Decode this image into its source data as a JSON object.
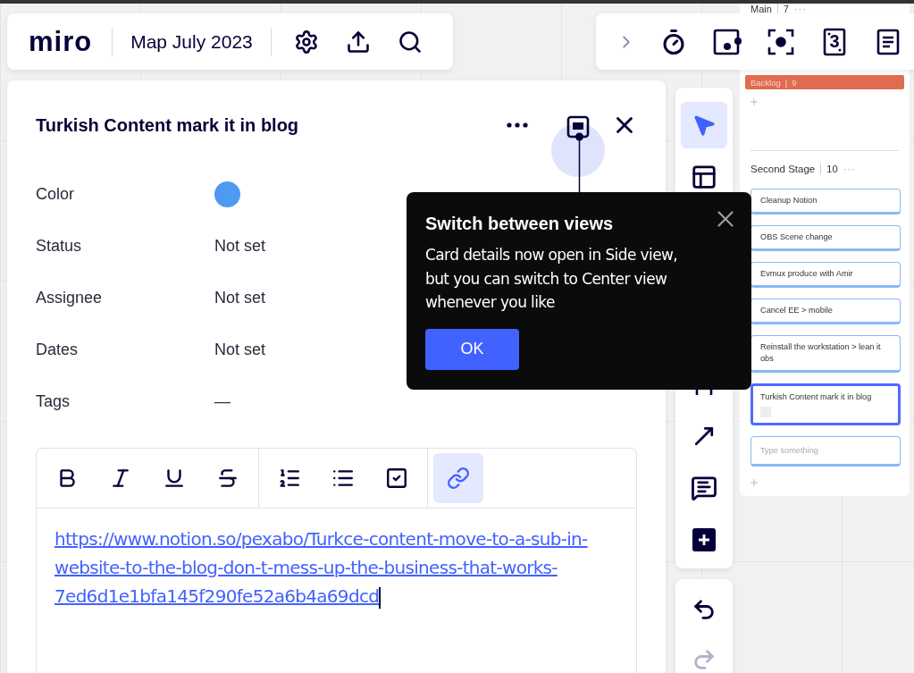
{
  "header": {
    "logo": "miro",
    "board_title": "Map July 2023",
    "tools": [
      {
        "kind": "settings"
      },
      {
        "kind": "upload"
      },
      {
        "kind": "search"
      }
    ]
  },
  "top_tools": [
    {
      "kind": "expand"
    },
    {
      "kind": "timer"
    },
    {
      "kind": "card-dot"
    },
    {
      "kind": "focus"
    },
    {
      "kind": "card-number",
      "label": "3"
    },
    {
      "kind": "notes"
    }
  ],
  "card_panel": {
    "title": "Turkish Content mark it in blog",
    "view_toggle_highlighted": true,
    "fields": [
      {
        "label": "Color",
        "kind": "color",
        "color": "#4e9af1"
      },
      {
        "label": "Status",
        "kind": "text",
        "value": "Not set"
      },
      {
        "label": "Assignee",
        "kind": "text",
        "value": "Not set"
      },
      {
        "label": "Dates",
        "kind": "text",
        "value": "Not set"
      },
      {
        "label": "Tags",
        "kind": "text",
        "value": "—"
      }
    ],
    "editor": {
      "tools": [
        {
          "kind": "bold",
          "selected": false
        },
        {
          "kind": "italic",
          "selected": false
        },
        {
          "kind": "underline",
          "selected": false
        },
        {
          "kind": "strike",
          "selected": false
        },
        {
          "kind": "ordered-list",
          "selected": false
        },
        {
          "kind": "bullet-list",
          "selected": false
        },
        {
          "kind": "checklist",
          "selected": false
        },
        {
          "kind": "link",
          "selected": true
        }
      ],
      "link": "https://www.notion.so/pexabo/Turkce-content-move-to-a-sub-in-website-to-the-blog-don-t-mess-up-the-business-that-works-7ed6d1e1bfa145f290fe52a6b4a69dcd"
    }
  },
  "tooltip": {
    "title": "Switch between views",
    "body": "Card details now open in Side view, but you can switch to Center view whenever you like",
    "button": "OK"
  },
  "toolbar": {
    "tools": [
      {
        "kind": "select",
        "selected": true
      },
      {
        "kind": "layout",
        "selected": false
      },
      {
        "kind": "arch",
        "selected": false
      },
      {
        "kind": "arrow",
        "selected": false
      },
      {
        "kind": "comment",
        "selected": false
      },
      {
        "kind": "add",
        "selected": false
      }
    ],
    "history": [
      {
        "kind": "undo",
        "disabled": false
      },
      {
        "kind": "redo",
        "disabled": true
      }
    ]
  },
  "board": {
    "top_column": {
      "title": "Main",
      "count": "7",
      "menu": "···"
    },
    "backlog": {
      "title": "Backlog",
      "separator": "|",
      "count": "9",
      "color": "#e06c50"
    },
    "column": {
      "title": "Second Stage",
      "count": "10",
      "menu": "···",
      "cards": [
        {
          "text": "Cleanup Notion",
          "selected": false
        },
        {
          "text": "OBS Scene change",
          "selected": false
        },
        {
          "text": "Evmux produce with Amir",
          "selected": false
        },
        {
          "text": "Cancel EE > mobile",
          "selected": false
        },
        {
          "text": "Reinstall the workstation > lean it obs",
          "selected": false
        },
        {
          "text": "Turkish Content mark it in blog",
          "selected": true
        }
      ],
      "placeholder": "Type something"
    }
  }
}
